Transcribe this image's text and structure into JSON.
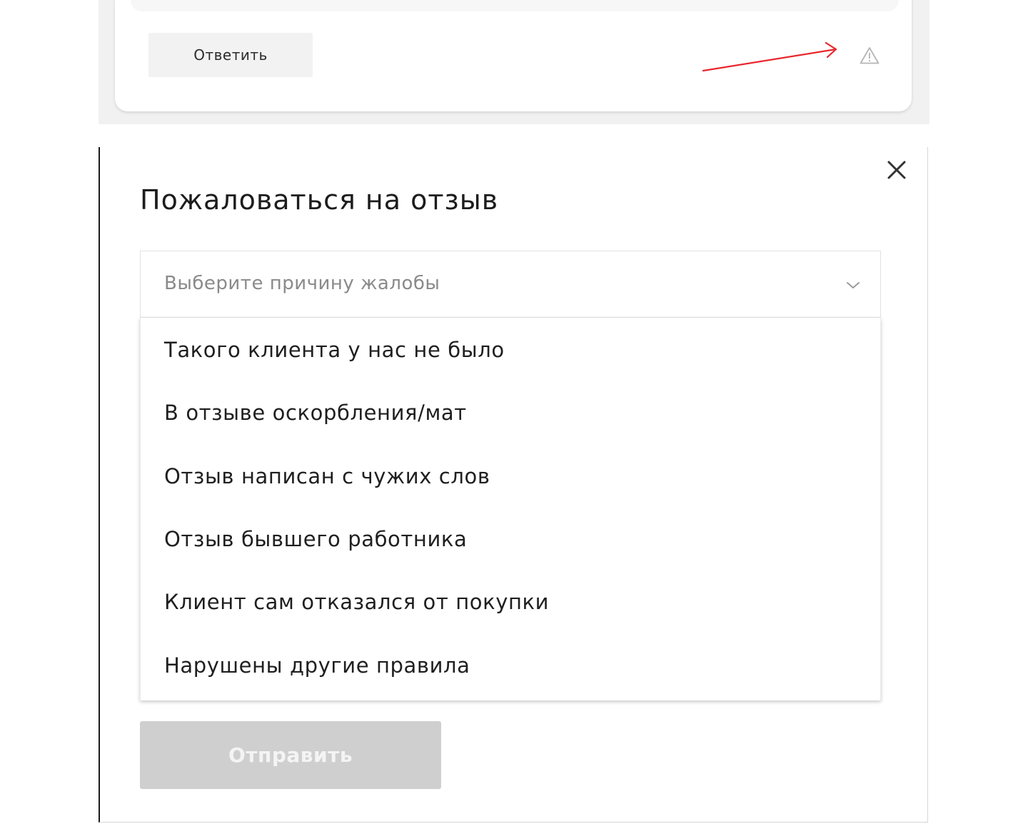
{
  "review_card": {
    "reply_label": "Ответить",
    "report_icon": "warning-triangle-icon",
    "annotation_color": "#e8262b"
  },
  "modal": {
    "title": "Пожаловаться на отзыв",
    "close_icon": "close-icon",
    "select": {
      "placeholder": "Выберите причину жалобы",
      "icon": "chevron-down-icon"
    },
    "options": [
      "Такого клиента у нас не было",
      "В отзыве оскорбления/мат",
      "Отзыв написан с чужих слов",
      "Отзыв бывшего работника",
      "Клиент сам отказался от покупки",
      "Нарушены другие правила"
    ],
    "submit_label": "Отправить",
    "submit_disabled": true
  }
}
